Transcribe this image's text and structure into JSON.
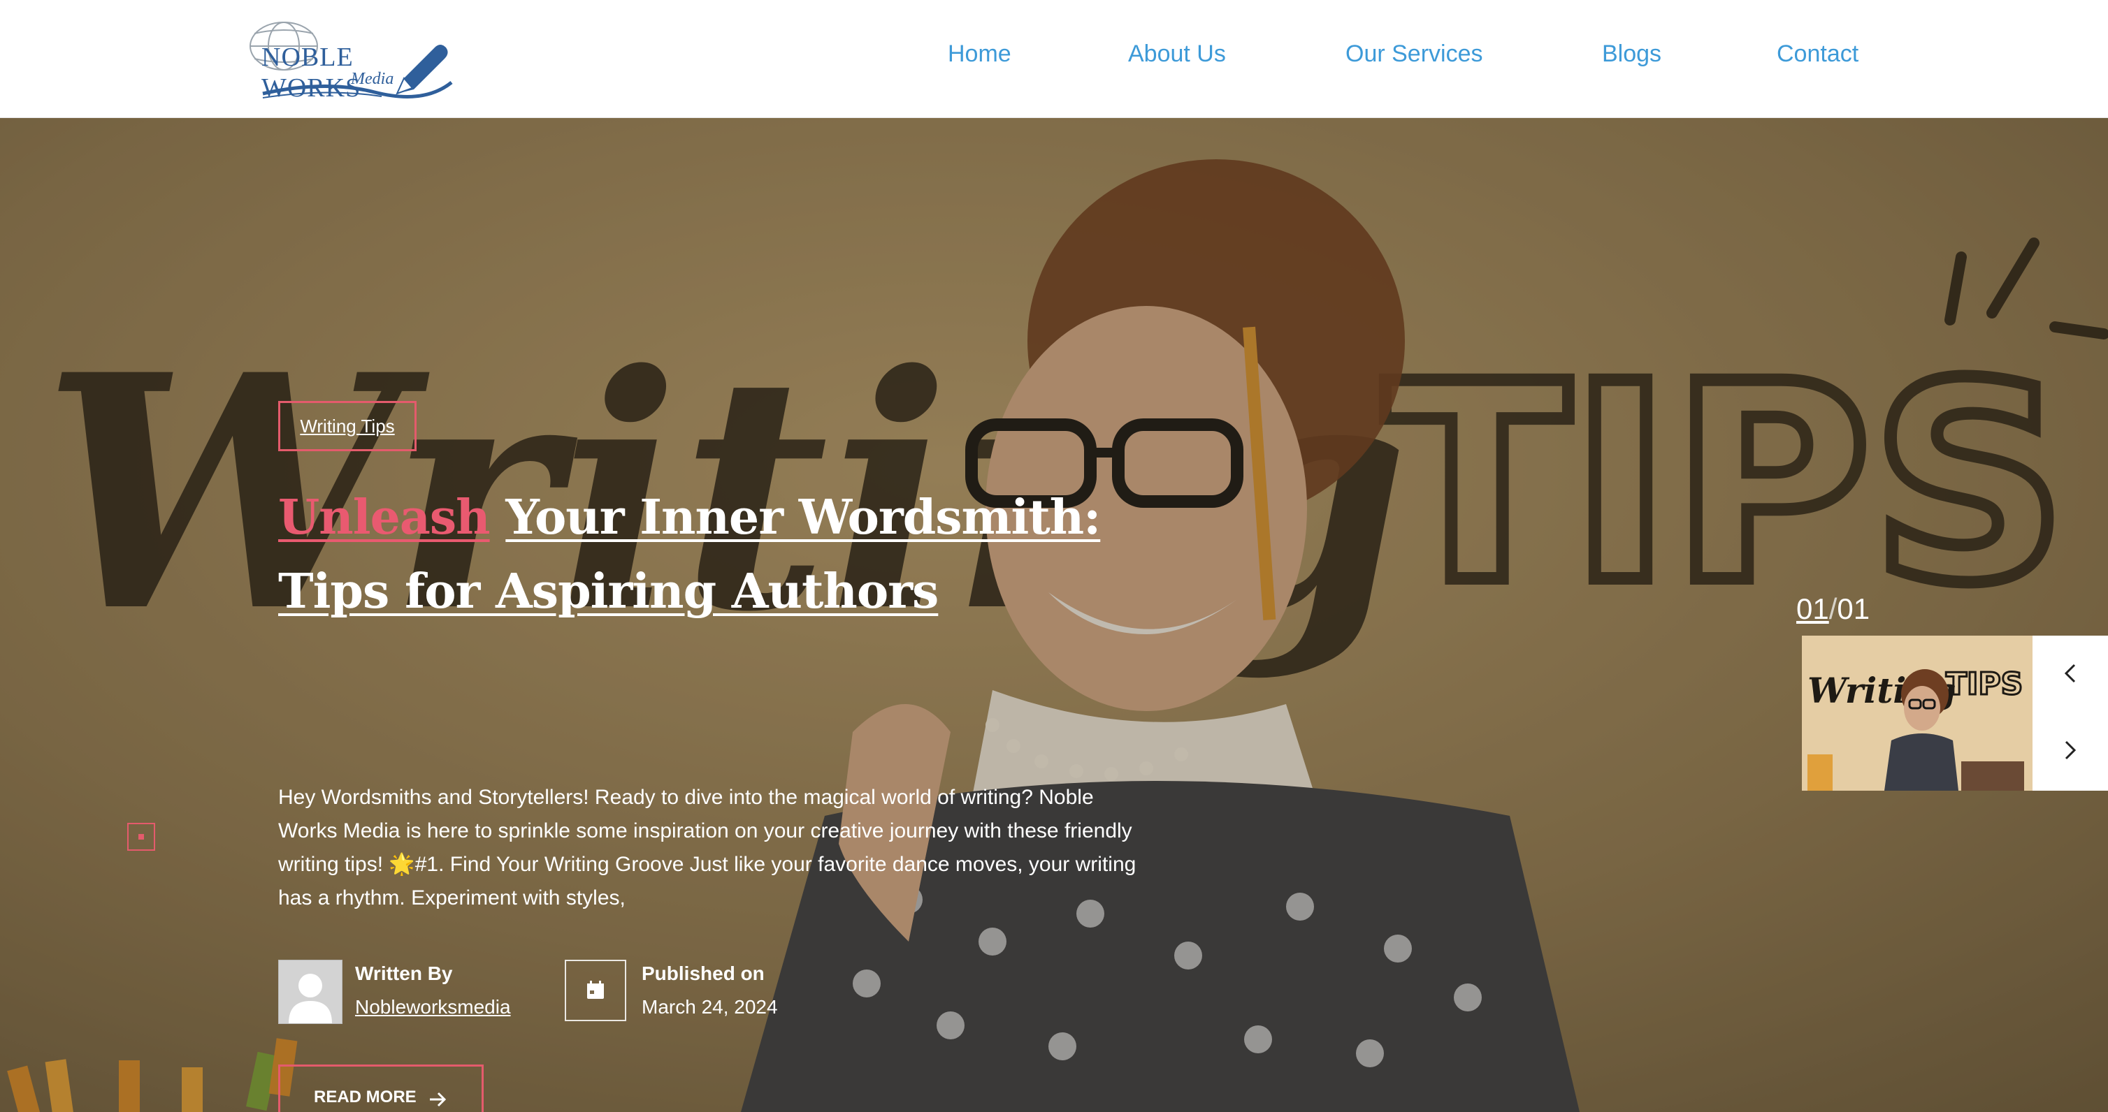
{
  "header": {
    "logo": {
      "line1": "NOBLE WORKS",
      "line2": "Media"
    },
    "nav": [
      {
        "label": "Home"
      },
      {
        "label": "About Us"
      },
      {
        "label": "Our Services"
      },
      {
        "label": "Blogs"
      },
      {
        "label": "Contact"
      }
    ]
  },
  "hero": {
    "category": "Writing Tips",
    "title_accent": "Unleash",
    "title_rest": "Your Inner Wordsmith: Tips for Aspiring Authors",
    "excerpt": "Hey Wordsmiths and Storytellers! Ready to dive into the magical world of writing? Noble Works Media is here to sprinkle some inspiration on your creative journey with these friendly writing tips! 🌟#1. Find Your Writing Groove Just like your favorite dance moves, your writing has a rhythm. Experiment with styles,",
    "author_label": "Written By",
    "author_name": "Nobleworksmedia",
    "published_label": "Published on",
    "published_date": "March 24, 2024",
    "read_more": "READ MORE",
    "background_text": {
      "left": "Writing",
      "right": "TIPS"
    }
  },
  "slider": {
    "current": "01",
    "separator": "/",
    "total": "01",
    "thumb_text": {
      "left": "Writing",
      "right": "TIPS"
    }
  },
  "colors": {
    "accent": "#e95a70",
    "nav": "#3d9ad8",
    "logo": "#2f5f9b"
  },
  "icons": [
    "globe-logo-icon",
    "pen-icon",
    "calendar-icon",
    "arrow-right-icon",
    "chevron-left-icon",
    "chevron-right-icon"
  ]
}
